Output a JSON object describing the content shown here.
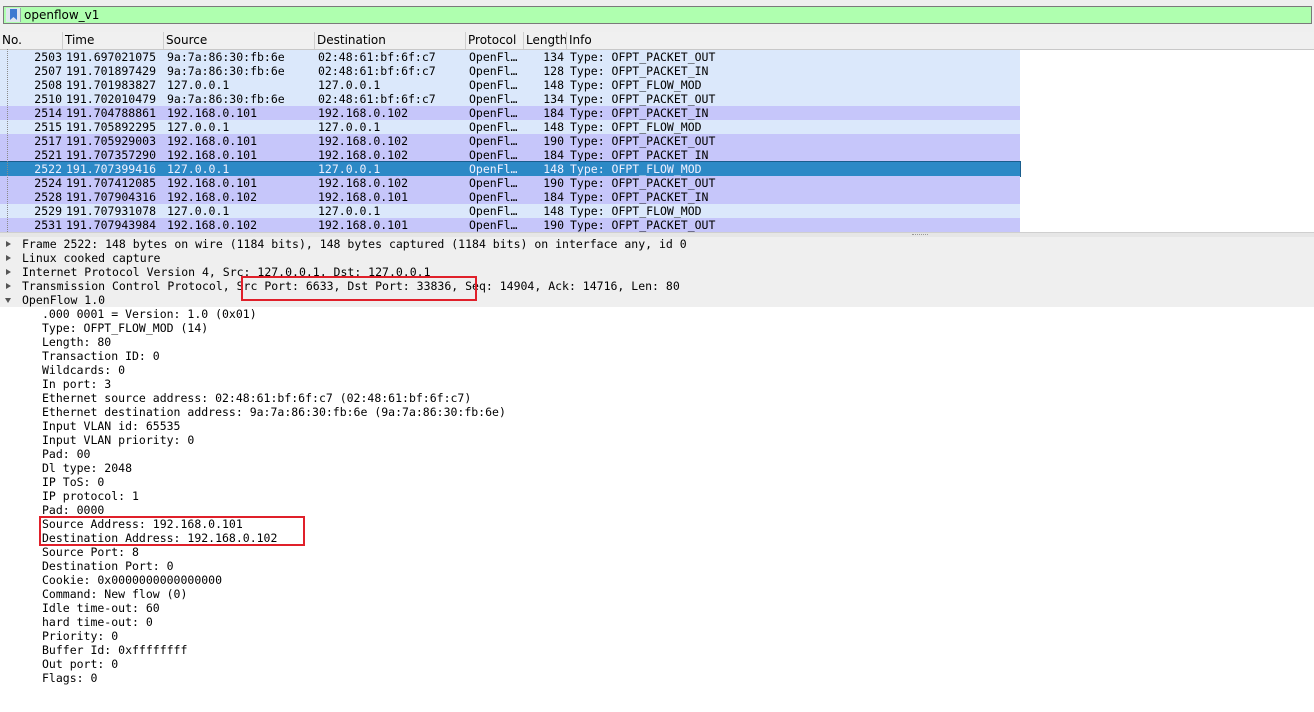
{
  "filter": {
    "value": "openflow_v1"
  },
  "columns": [
    "No.",
    "Time",
    "Source",
    "Destination",
    "Protocol",
    "Length",
    "Info"
  ],
  "packets": [
    {
      "no": "2503",
      "time": "191.697021075",
      "src": "9a:7a:86:30:fb:6e",
      "dst": "02:48:61:bf:6f:c7",
      "proto": "OpenFl…",
      "len": "134",
      "info": "Type: OFPT_PACKET_OUT",
      "style": "light"
    },
    {
      "no": "2507",
      "time": "191.701897429",
      "src": "9a:7a:86:30:fb:6e",
      "dst": "02:48:61:bf:6f:c7",
      "proto": "OpenFl…",
      "len": "128",
      "info": "Type: OFPT_PACKET_IN",
      "style": "light"
    },
    {
      "no": "2508",
      "time": "191.701983827",
      "src": "127.0.0.1",
      "dst": "127.0.0.1",
      "proto": "OpenFl…",
      "len": "148",
      "info": "Type: OFPT_FLOW_MOD",
      "style": "light"
    },
    {
      "no": "2510",
      "time": "191.702010479",
      "src": "9a:7a:86:30:fb:6e",
      "dst": "02:48:61:bf:6f:c7",
      "proto": "OpenFl…",
      "len": "134",
      "info": "Type: OFPT_PACKET_OUT",
      "style": "light"
    },
    {
      "no": "2514",
      "time": "191.704788861",
      "src": "192.168.0.101",
      "dst": "192.168.0.102",
      "proto": "OpenFl…",
      "len": "184",
      "info": "Type: OFPT_PACKET_IN",
      "style": "dark"
    },
    {
      "no": "2515",
      "time": "191.705892295",
      "src": "127.0.0.1",
      "dst": "127.0.0.1",
      "proto": "OpenFl…",
      "len": "148",
      "info": "Type: OFPT_FLOW_MOD",
      "style": "light"
    },
    {
      "no": "2517",
      "time": "191.705929003",
      "src": "192.168.0.101",
      "dst": "192.168.0.102",
      "proto": "OpenFl…",
      "len": "190",
      "info": "Type: OFPT_PACKET_OUT",
      "style": "dark"
    },
    {
      "no": "2521",
      "time": "191.707357290",
      "src": "192.168.0.101",
      "dst": "192.168.0.102",
      "proto": "OpenFl…",
      "len": "184",
      "info": "Type: OFPT_PACKET_IN",
      "style": "dark"
    },
    {
      "no": "2522",
      "time": "191.707399416",
      "src": "127.0.0.1",
      "dst": "127.0.0.1",
      "proto": "OpenFl…",
      "len": "148",
      "info": "Type: OFPT_FLOW_MOD",
      "style": "sel"
    },
    {
      "no": "2524",
      "time": "191.707412085",
      "src": "192.168.0.101",
      "dst": "192.168.0.102",
      "proto": "OpenFl…",
      "len": "190",
      "info": "Type: OFPT_PACKET_OUT",
      "style": "dark"
    },
    {
      "no": "2528",
      "time": "191.707904316",
      "src": "192.168.0.102",
      "dst": "192.168.0.101",
      "proto": "OpenFl…",
      "len": "184",
      "info": "Type: OFPT_PACKET_IN",
      "style": "dark"
    },
    {
      "no": "2529",
      "time": "191.707931078",
      "src": "127.0.0.1",
      "dst": "127.0.0.1",
      "proto": "OpenFl…",
      "len": "148",
      "info": "Type: OFPT_FLOW_MOD",
      "style": "light"
    },
    {
      "no": "2531",
      "time": "191.707943984",
      "src": "192.168.0.102",
      "dst": "192.168.0.101",
      "proto": "OpenFl…",
      "len": "190",
      "info": "Type: OFPT_PACKET_OUT",
      "style": "dark"
    }
  ],
  "details": [
    {
      "text": "Frame 2522: 148 bytes on wire (1184 bits), 148 bytes captured (1184 bits) on interface any, id 0",
      "level": 0,
      "expand": "right"
    },
    {
      "text": "Linux cooked capture",
      "level": 0,
      "expand": "right"
    },
    {
      "text": "Internet Protocol Version 4, Src: 127.0.0.1, Dst: 127.0.0.1",
      "level": 0,
      "expand": "right"
    },
    {
      "text": "Transmission Control Protocol, Src Port: 6633, Dst Port: 33836, Seq: 14904, Ack: 14716, Len: 80",
      "level": 0,
      "expand": "right"
    },
    {
      "text": "OpenFlow 1.0",
      "level": 0,
      "expand": "down"
    },
    {
      "text": ".000 0001 = Version: 1.0 (0x01)",
      "level": 1
    },
    {
      "text": "Type: OFPT_FLOW_MOD (14)",
      "level": 1
    },
    {
      "text": "Length: 80",
      "level": 1
    },
    {
      "text": "Transaction ID: 0",
      "level": 1
    },
    {
      "text": "Wildcards: 0",
      "level": 1
    },
    {
      "text": "In port: 3",
      "level": 1
    },
    {
      "text": "Ethernet source address: 02:48:61:bf:6f:c7 (02:48:61:bf:6f:c7)",
      "level": 1
    },
    {
      "text": "Ethernet destination address: 9a:7a:86:30:fb:6e (9a:7a:86:30:fb:6e)",
      "level": 1
    },
    {
      "text": "Input VLAN id: 65535",
      "level": 1
    },
    {
      "text": "Input VLAN priority: 0",
      "level": 1
    },
    {
      "text": "Pad: 00",
      "level": 1
    },
    {
      "text": "Dl type: 2048",
      "level": 1
    },
    {
      "text": "IP ToS: 0",
      "level": 1
    },
    {
      "text": "IP protocol: 1",
      "level": 1
    },
    {
      "text": "Pad: 0000",
      "level": 1
    },
    {
      "text": "Source Address: 192.168.0.101",
      "level": 1
    },
    {
      "text": "Destination Address: 192.168.0.102",
      "level": 1
    },
    {
      "text": "Source Port: 8",
      "level": 1
    },
    {
      "text": "Destination Port: 0",
      "level": 1
    },
    {
      "text": "Cookie: 0x0000000000000000",
      "level": 1
    },
    {
      "text": "Command: New flow (0)",
      "level": 1
    },
    {
      "text": "Idle time-out: 60",
      "level": 1
    },
    {
      "text": "hard time-out: 0",
      "level": 1
    },
    {
      "text": "Priority: 0",
      "level": 1
    },
    {
      "text": "Buffer Id: 0xffffffff",
      "level": 1
    },
    {
      "text": "Out port: 0",
      "level": 1
    },
    {
      "text": "Flags: 0",
      "level": 1
    }
  ],
  "colors": {
    "filter_ok": "#afffaf",
    "row_light": "#dbe8fb",
    "row_dark": "#c6c6fa",
    "row_selected": "#2c89c6",
    "highlight_box": "#e0202a"
  }
}
